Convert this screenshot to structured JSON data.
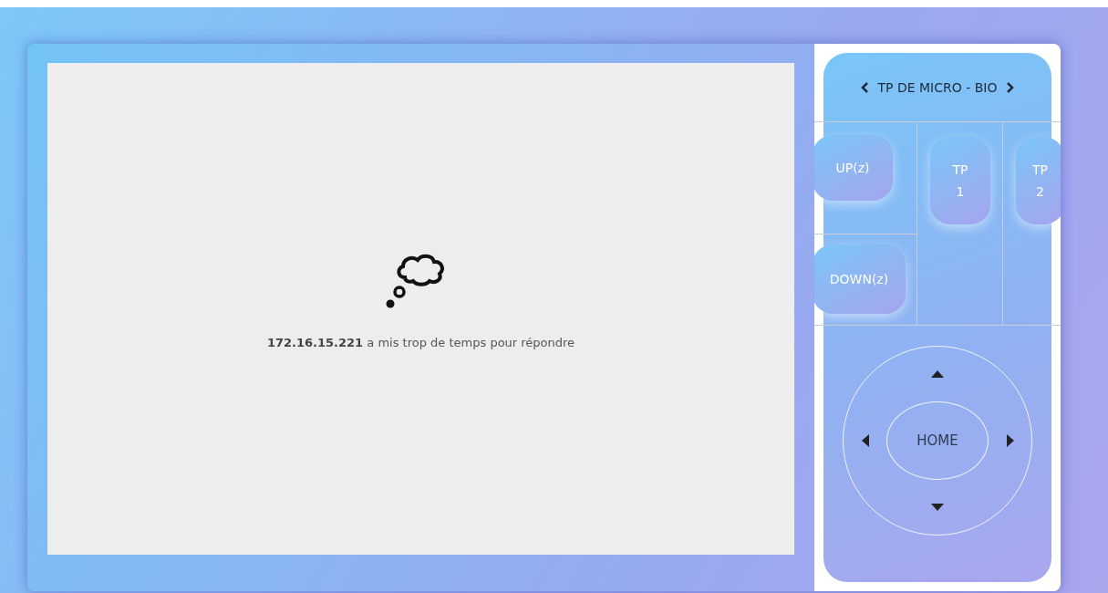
{
  "viewer": {
    "message": "**172.16.15.221** a mis trop de temps pour répondre"
  },
  "remote": {
    "title": "TP DE MICRO - BIO",
    "buttons": [
      {
        "label": "UP(z)",
        "kind": "up"
      },
      {
        "label": "TP 1",
        "kind": "tp"
      },
      {
        "label": "TP 2",
        "kind": "tp"
      },
      {
        "label": "DOWN(z)",
        "kind": "down"
      }
    ],
    "dpad": {
      "center": "HOME"
    }
  }
}
